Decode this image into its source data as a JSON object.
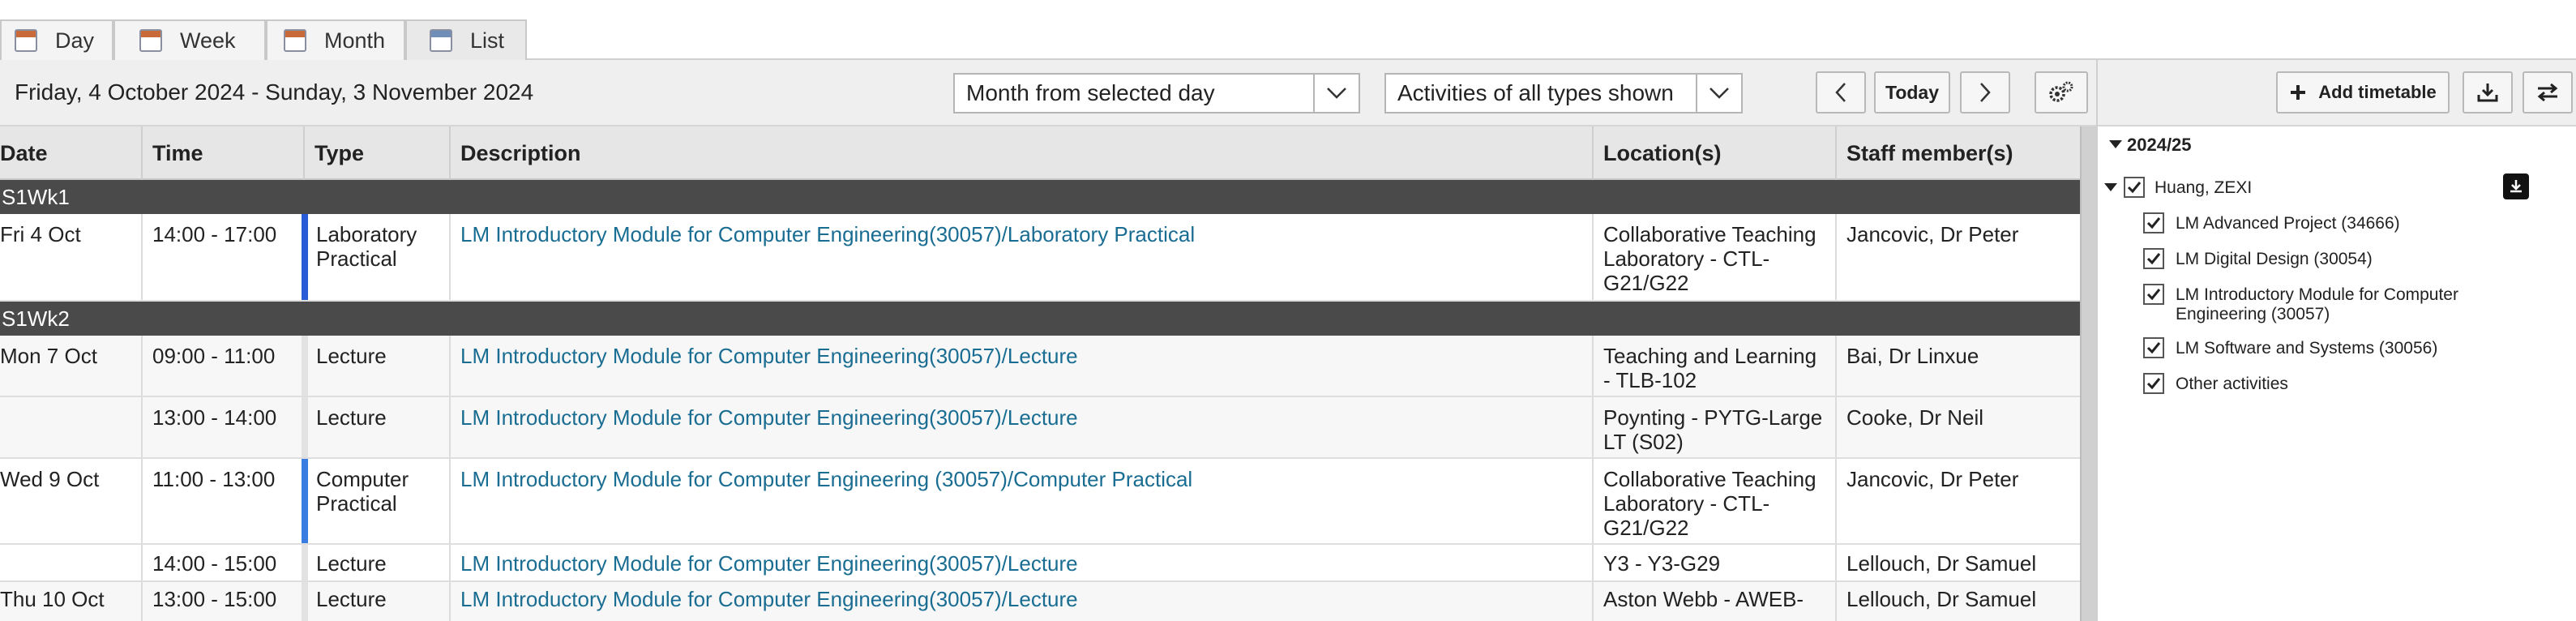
{
  "tabs": [
    {
      "label": "Day",
      "icon": "calendar-day-icon"
    },
    {
      "label": "Week",
      "icon": "calendar-week-icon"
    },
    {
      "label": "Month",
      "icon": "calendar-month-icon"
    },
    {
      "label": "List",
      "icon": "list-icon",
      "active": true
    }
  ],
  "toolbar": {
    "date_range": "Friday, 4 October 2024 - Sunday, 3 November 2024",
    "period_select": "Month from selected day",
    "type_select": "Activities of all types shown",
    "today": "Today"
  },
  "panel": {
    "add_timetable": "Add timetable",
    "year": "2024/25",
    "person": "Huang, ZEXI",
    "modules": [
      "LM Advanced Project (34666)",
      "LM Digital Design (30054)",
      "LM Introductory Module for Computer Engineering (30057)",
      "LM Software and Systems (30056)",
      "Other activities"
    ]
  },
  "columns": [
    "Date",
    "Time",
    "Type",
    "Description",
    "Location(s)",
    "Staff member(s)"
  ],
  "weeks": [
    "S1Wk1",
    "S1Wk2"
  ],
  "rows": [
    {
      "date": "Fri 4 Oct",
      "time": "14:00 - 17:00",
      "type": "Laboratory Practical",
      "description": "LM Introductory Module for Computer Engineering(30057)/Laboratory Practical",
      "location": "Collaborative Teaching Laboratory - CTL-G21/G22",
      "staff": "Jancovic, Dr Peter"
    },
    {
      "date": "Mon 7 Oct",
      "time": "09:00 - 11:00",
      "type": "Lecture",
      "description": "LM Introductory Module for Computer Engineering(30057)/Lecture",
      "location": "Teaching and Learning - TLB-102",
      "staff": "Bai, Dr Linxue"
    },
    {
      "date": "",
      "time": "13:00 - 14:00",
      "type": "Lecture",
      "description": "LM Introductory Module for Computer Engineering(30057)/Lecture",
      "location": "Poynting - PYTG-Large LT (S02)",
      "staff": "Cooke, Dr Neil"
    },
    {
      "date": "Wed 9 Oct",
      "time": "11:00 - 13:00",
      "type": "Computer Practical",
      "description": "LM Introductory Module for Computer Engineering (30057)/Computer Practical",
      "location": "Collaborative Teaching Laboratory - CTL-G21/G22",
      "staff": "Jancovic, Dr Peter"
    },
    {
      "date": "",
      "time": "14:00 - 15:00",
      "type": "Lecture",
      "description": "LM Introductory Module for Computer Engineering(30057)/Lecture",
      "location": "Y3 - Y3-G29",
      "staff": "Lellouch, Dr Samuel"
    },
    {
      "date": "Thu 10 Oct",
      "time": "13:00 - 15:00",
      "type": "Lecture",
      "description": "LM Introductory Module for Computer Engineering(30057)/Lecture",
      "location": "Aston Webb - AWEB-",
      "staff": "Lellouch, Dr Samuel"
    }
  ],
  "colors": {
    "accent_link": "#1a6d92",
    "week_bar": "#4a4a4a",
    "practical_marker": "#2a5bd7",
    "lecture_marker": "#cfcfcf"
  }
}
